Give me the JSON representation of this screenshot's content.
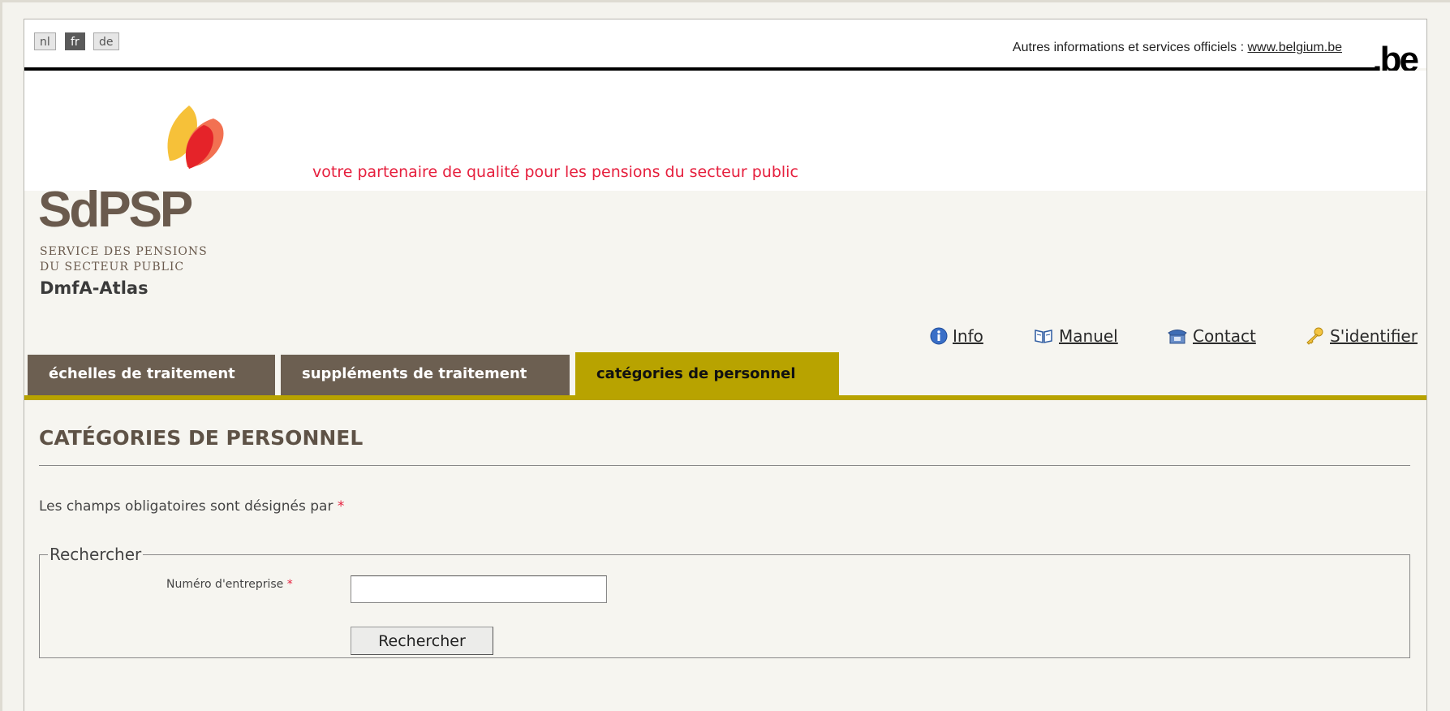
{
  "languages": [
    "nl",
    "fr",
    "de"
  ],
  "official_info": {
    "text": "Autres informations et services officiels : ",
    "link": "www.belgium.be"
  },
  "be_logo": ".be",
  "logo": {
    "letters": "SdPSP",
    "line1": "SERVICE DES PENSIONS",
    "line2": "DU SECTEUR PUBLIC"
  },
  "tagline": "votre partenaire de qualité pour les pensions du secteur public",
  "app_title": "DmfA-Atlas",
  "utility_links": {
    "info": "Info",
    "manual": "Manuel",
    "contact": "Contact",
    "login": "S'identifier"
  },
  "tabs": [
    {
      "label": "échelles de traitement"
    },
    {
      "label": "suppléments de traitement"
    },
    {
      "label": "catégories de personnel"
    }
  ],
  "section_title": "CATÉGORIES DE PERSONNEL",
  "required_note": "Les champs obligatoires sont désignés par ",
  "required_star": "*",
  "search": {
    "legend": "Rechercher",
    "field_label": "Numéro d'entreprise",
    "field_value": "",
    "button": "Rechercher"
  },
  "colors": {
    "tab_inactive": "#6c5f51",
    "tab_active": "#b8a300",
    "tagline": "#e6203e",
    "logo": "#6a5a4d"
  }
}
